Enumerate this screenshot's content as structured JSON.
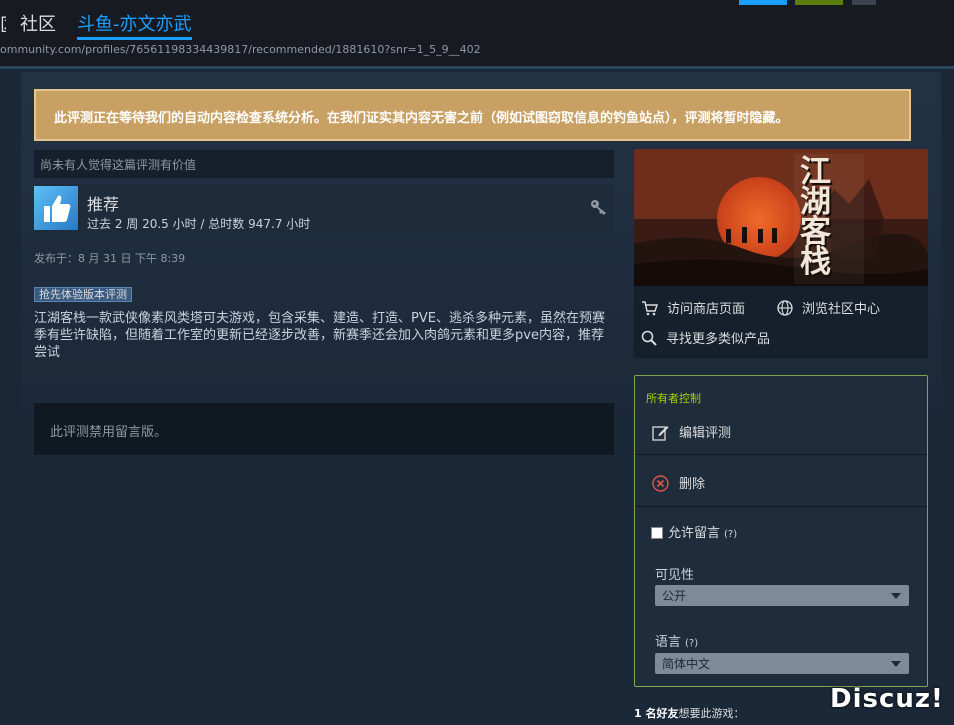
{
  "header": {
    "left_fragment": "区",
    "community_label": "社区",
    "user_label": "斗鱼-亦文亦武",
    "url": "ommunity.com/profiles/76561198334439817/recommended/1881610?snr=1_5_9__402"
  },
  "notice": {
    "text": "此评测正在等待我们的自动内容检查系统分析。在我们证实其内容无害之前（例如试图窃取信息的钓鱼站点），评测将暂时隐藏。"
  },
  "review": {
    "helpful_text": "尚未有人觉得这篇评测有价值",
    "verdict": "推荐",
    "hours": "过去 2 周 20.5 小时 / 总时数 947.7 小时",
    "posted": "发布于：8 月 31 日 下午 8:39",
    "early_access_badge": "抢先体验版本评测",
    "body": "江湖客栈一款武侠像素风类塔可夫游戏，包含采集、建造、打造、PVE、逃杀多种元素，虽然在预赛季有些许缺陷，但随着工作室的更新已经逐步改善，新赛季还会加入肉鸽元素和更多pve内容，推荐尝试",
    "comments_disabled": "此评测禁用留言版。"
  },
  "game": {
    "art_text": "江湖客栈",
    "links": {
      "store": "访问商店页面",
      "community": "浏览社区中心",
      "similar": "寻找更多类似产品"
    }
  },
  "owner": {
    "title": "所有者控制",
    "edit_label": "编辑评测",
    "delete_label": "删除",
    "allow_comments_label": "允许留言",
    "help_mark": "(?)",
    "visibility_label": "可见性",
    "visibility_value": "公开",
    "language_label": "语言",
    "language_value": "简体中文"
  },
  "friends": {
    "count": "1 名好友",
    "suffix": "想要此游戏："
  },
  "watermark": "Discuz!",
  "colors": {
    "background": "#1b2838",
    "accent_blue": "#1a9fff",
    "notice_bg": "#c9a063",
    "owner_border": "#7ea64b",
    "owner_title": "#a4d007"
  }
}
